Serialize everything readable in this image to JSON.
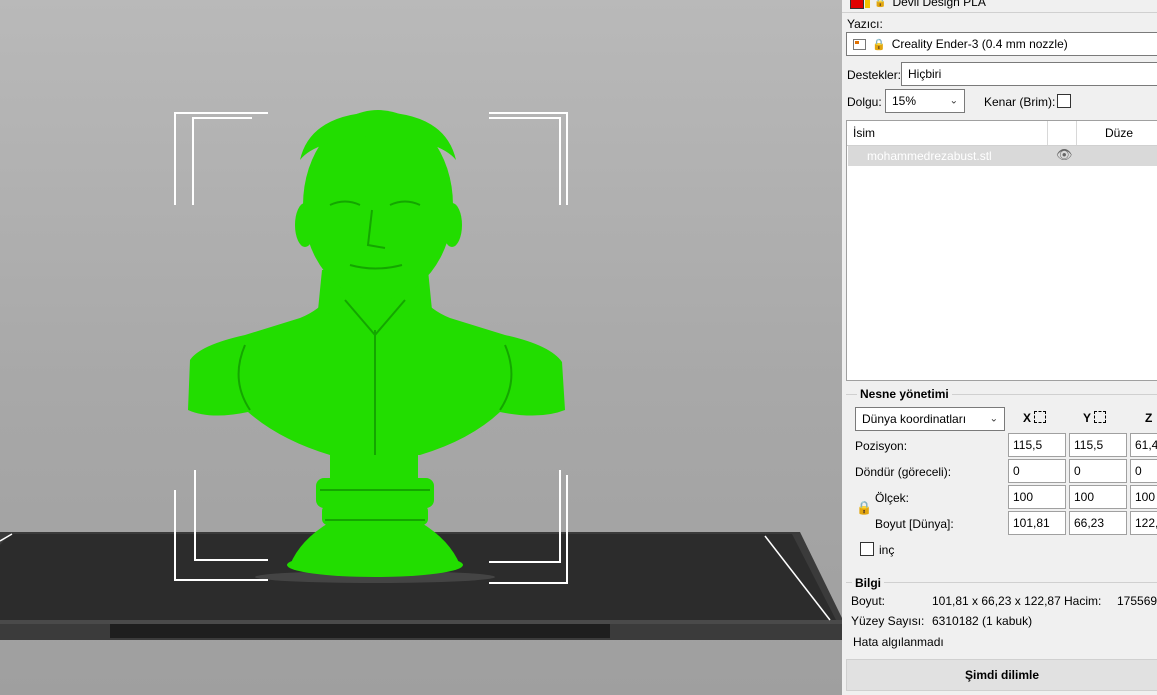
{
  "material": {
    "name": "Devil Design PLA",
    "swatch_color": "#e00000"
  },
  "printer": {
    "label": "Yazıcı:",
    "value": "Creality Ender-3 (0.4 mm nozzle)"
  },
  "supports": {
    "label": "Destekler:",
    "value": "Hiçbiri"
  },
  "infill": {
    "label": "Dolgu:",
    "value": "15%"
  },
  "brim": {
    "label": "Kenar (Brim):",
    "checked": false
  },
  "object_list": {
    "col_name": "İsim",
    "col_edit": "Düze",
    "items": [
      {
        "name": "mohammedrezabust.stl",
        "visible": true
      }
    ]
  },
  "object_management": {
    "title": "Nesne yönetimi",
    "coord_system": "Dünya koordinatları",
    "axis_x": "X",
    "axis_y": "Y",
    "axis_z": "Z",
    "position": {
      "label": "Pozisyon:",
      "x": "115,5",
      "y": "115,5",
      "z": "61,4"
    },
    "rotate": {
      "label": "Döndür (göreceli):",
      "x": "0",
      "y": "0",
      "z": "0"
    },
    "scale": {
      "label": "Ölçek:",
      "x": "100",
      "y": "100",
      "z": "100"
    },
    "size": {
      "label": "Boyut [Dünya]:",
      "x": "101,81",
      "y": "66,23",
      "z": "122,"
    },
    "inch": {
      "label": "inç",
      "checked": false
    }
  },
  "info": {
    "title": "Bilgi",
    "size_label": "Boyut:",
    "size_value": "101,81 x 66,23 x 122,87",
    "volume_label": "Hacim:",
    "volume_value": "175569,",
    "faces_label": "Yüzey Sayısı:",
    "faces_value": "6310182 (1 kabuk)",
    "error_text": "Hata algılanmadı"
  },
  "slice_button": "Şimdi dilimle",
  "viewport": {
    "model_color": "#22dd00",
    "bed_color": "#3a3a3a"
  }
}
